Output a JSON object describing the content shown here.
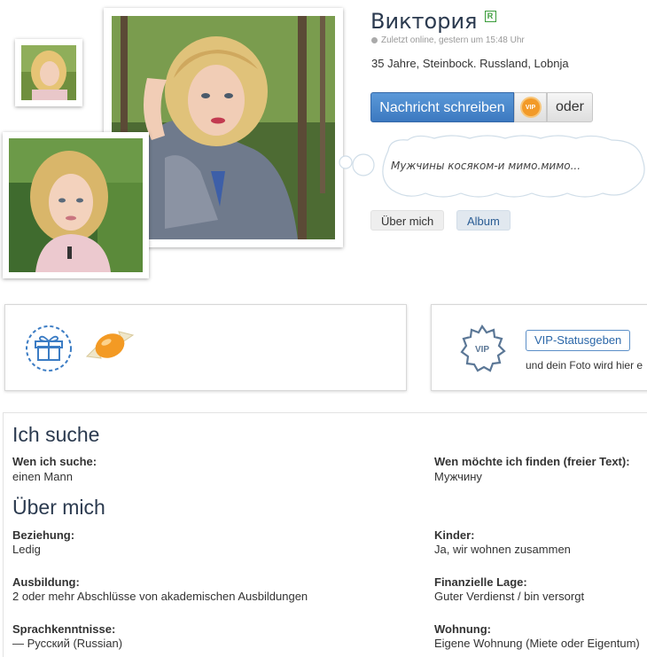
{
  "profile": {
    "name": "Виктория",
    "verified_badge": "R",
    "online_status": "Zuletzt online, gestern um 15:48 Uhr",
    "details": "35 Jahre, Steinbock. Russland, Lobnja",
    "status_message": "Мужчины косяком-и мимо.мимо..."
  },
  "actions": {
    "message_button": "Nachricht schreiben",
    "vip_badge": "VIP",
    "or_button": "oder"
  },
  "tabs": [
    {
      "label": "Über mich"
    },
    {
      "label": "Album"
    }
  ],
  "vip_card": {
    "badge": "VIP",
    "button": "VIP-Statusgeben",
    "subtitle": "und dein Foto wird hier e"
  },
  "sections": {
    "seeking": {
      "title": "Ich suche",
      "fields": [
        {
          "label": "Wen ich suche:",
          "value": "einen Mann"
        },
        {
          "label": "Wen möchte ich finden (freier Text):",
          "value": "Мужчину"
        }
      ]
    },
    "about": {
      "title": "Über mich",
      "fields": [
        {
          "label": "Beziehung:",
          "value": "Ledig"
        },
        {
          "label": "Kinder:",
          "value": "Ja, wir wohnen zusammen"
        },
        {
          "label": "Ausbildung:",
          "value": "2 oder mehr Abschlüsse von akademischen Ausbildungen"
        },
        {
          "label": "Finanzielle Lage:",
          "value": "Guter Verdienst / bin versorgt"
        },
        {
          "label": "Sprachkenntnisse:",
          "value": "— Русский (Russian)"
        },
        {
          "label": "Wohnung:",
          "value": "Eigene Wohnung (Miete oder Eigentum)"
        }
      ]
    }
  },
  "colors": {
    "accent_blue": "#3c79c0",
    "title_dark": "#2b3a4f",
    "vip_orange": "#f29a28",
    "verified_green": "#3a9c3a"
  }
}
